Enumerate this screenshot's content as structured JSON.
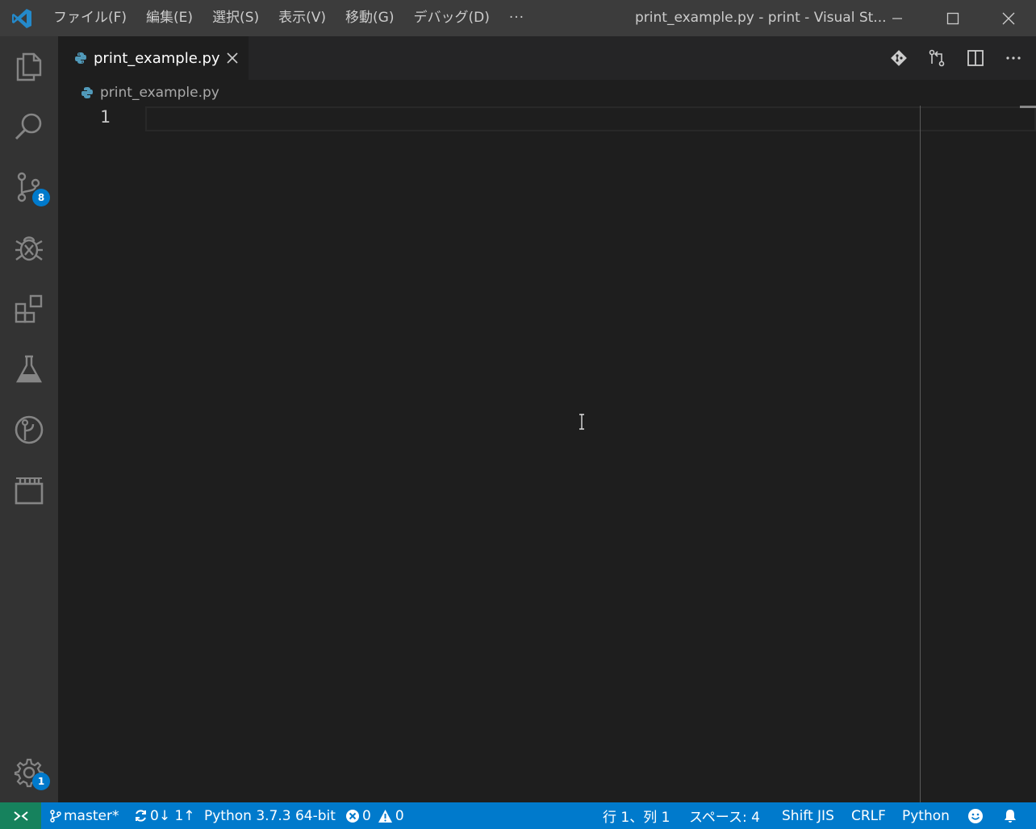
{
  "window": {
    "title": "print_example.py - print - Visual St...",
    "menu": [
      "ファイル(F)",
      "編集(E)",
      "選択(S)",
      "表示(V)",
      "移動(G)",
      "デバッグ(D)",
      "···"
    ]
  },
  "activity_bar": {
    "items": [
      {
        "icon": "explorer-icon"
      },
      {
        "icon": "search-icon"
      },
      {
        "icon": "source-control-icon",
        "badge": "8"
      },
      {
        "icon": "debug-icon"
      },
      {
        "icon": "extensions-icon"
      },
      {
        "icon": "test-flask-icon"
      },
      {
        "icon": "gitlens-icon"
      },
      {
        "icon": "board-icon"
      }
    ],
    "settings_badge": "1"
  },
  "tabs": [
    {
      "label": "print_example.py",
      "icon": "python-icon",
      "active": true
    }
  ],
  "breadcrumb": {
    "label": "print_example.py",
    "icon": "python-icon"
  },
  "editor": {
    "line_numbers": [
      "1"
    ]
  },
  "status_bar": {
    "branch": "master*",
    "sync": "0↓ 1↑",
    "interpreter": "Python 3.7.3 64-bit",
    "errors": "0",
    "warnings": "0",
    "position": "行 1、列 1",
    "spaces": "スペース: 4",
    "encoding": "Shift JIS",
    "eol": "CRLF",
    "language": "Python"
  },
  "colors": {
    "accent": "#007acc",
    "remote": "#16825d",
    "titlebar": "#3c3c3c",
    "activity_bar": "#333333",
    "editor_bg": "#1e1e1e"
  }
}
